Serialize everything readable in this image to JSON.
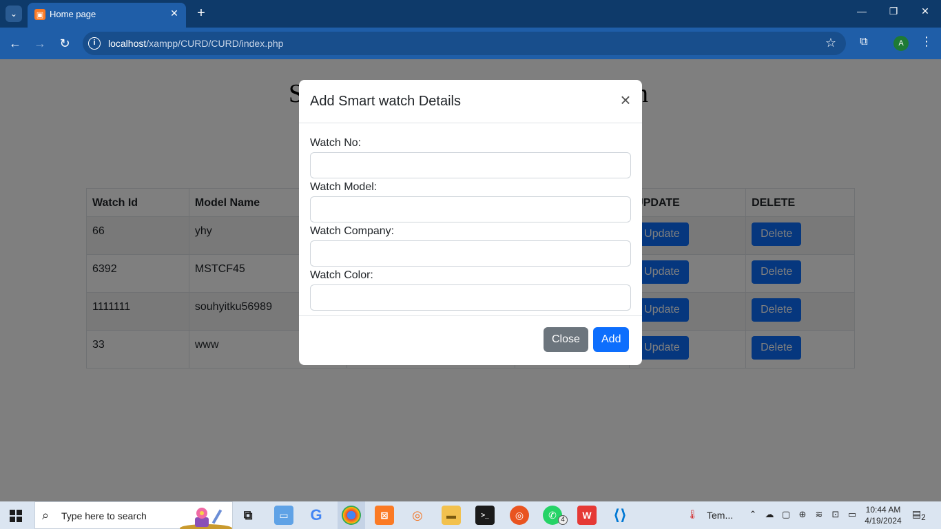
{
  "browser": {
    "tab_title": "Home page",
    "new_tab": "+",
    "url_host": "localhost",
    "url_path": "/xampp/CURD/CURD/index.php",
    "profile_initial": "A"
  },
  "page": {
    "heading_visible_start": "S",
    "heading_visible_end": "n",
    "table": {
      "headers": [
        "Watch Id",
        "Model Name",
        "",
        "",
        "UPDATE",
        "DELETE"
      ],
      "rows": [
        {
          "id": "66",
          "model": "yhy"
        },
        {
          "id": "6392",
          "model": "MSTCF45"
        },
        {
          "id": "1111111",
          "model": "souhyitku56989"
        },
        {
          "id": "33",
          "model": "www"
        }
      ],
      "update_label": "Update",
      "delete_label": "Delete"
    }
  },
  "modal": {
    "title": "Add Smart watch Details",
    "close_x": "×",
    "fields": [
      {
        "label": "Watch No:",
        "value": ""
      },
      {
        "label": "Watch Model:",
        "value": ""
      },
      {
        "label": "Watch Company:",
        "value": ""
      },
      {
        "label": "Watch Color:",
        "value": ""
      }
    ],
    "close_label": "Close",
    "add_label": "Add"
  },
  "taskbar": {
    "search_placeholder": "Type here to search",
    "weather_text": "Tem...",
    "time": "10:44 AM",
    "date": "4/19/2024",
    "whatsapp_badge": "4",
    "notification_count": "2"
  },
  "colors": {
    "chrome_dark": "#0e3a6a",
    "chrome_toolbar": "#1f5ea8",
    "primary": "#0d6efd",
    "secondary": "#6c757d"
  }
}
